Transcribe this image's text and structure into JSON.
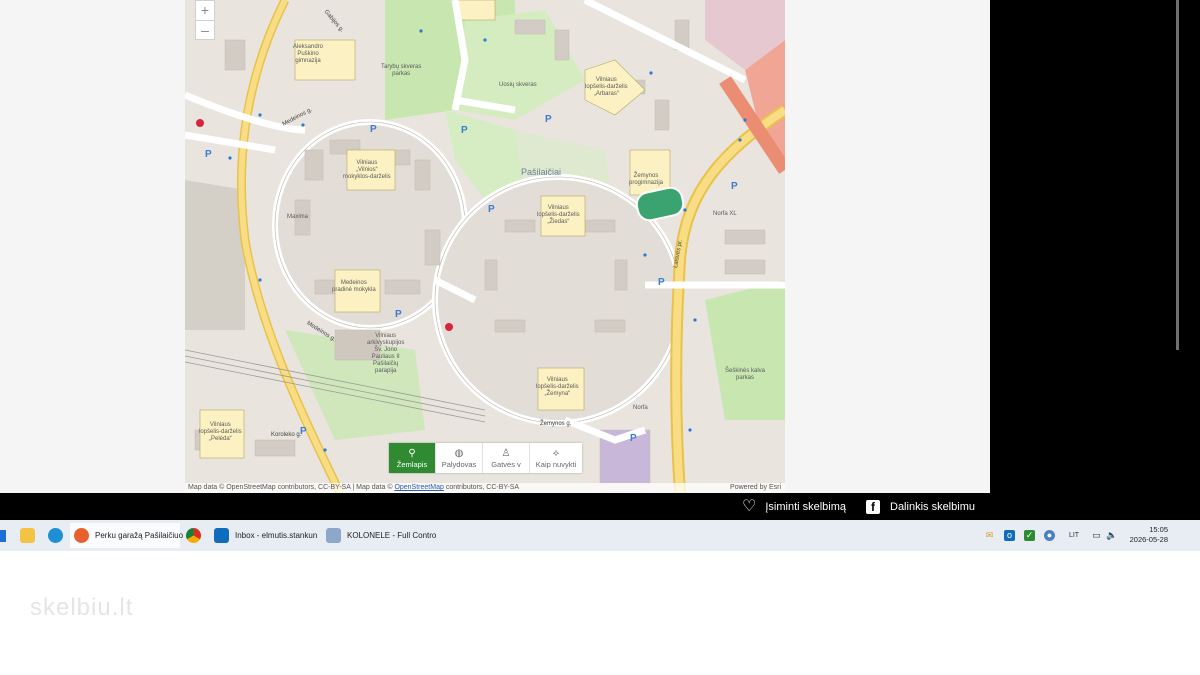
{
  "map": {
    "zoom_in": "+",
    "zoom_out": "–",
    "area_labels": [
      "Pašilaičiai",
      "Vilniaus\n„Vilnios“\nmokyklos-darželis",
      "Vilniaus\nlopšelis-darželis\n„Žiedas“",
      "Vilniaus\nlopšelis-darželis\n„Žemyna“",
      "Medeinos\npradinė mokykla",
      "Vilniaus\nlopšelis-darželis\n„Arbaras“",
      "Vilniaus\nlopšelis-darželis\n„Pelėda“",
      "Vilniaus\narkivyskupijos\nŠv. Jono\nPauliaus II\nPašilaičių\nparapija",
      "Tarybų skveras\nparkas",
      "Uosių skveras",
      "Aleksandro\nPuškino\ngimnazija",
      "Žemynos\nprogimnazija",
      "Šeškinės kalva\nparkas",
      "Norfa",
      "Maxima",
      "Norfa XL",
      "Medeinos g.",
      "Žemynos g.",
      "Laisvės pr.",
      "Medeinos g.",
      "Koroleko g.",
      "Gabijos g."
    ],
    "toolbar": [
      {
        "label": "Žemlapis",
        "icon": "map-pin-icon",
        "active": true
      },
      {
        "label": "Palydovas",
        "icon": "globe-icon",
        "active": false
      },
      {
        "label": "Gatvės v",
        "icon": "pegman-icon",
        "active": false
      },
      {
        "label": "Kaip nuvykti",
        "icon": "route-icon",
        "active": false
      }
    ],
    "attribution_prefix": "Map data © OpenStreetMap contributors, CC-BY-SA | Map data ©",
    "attribution_link": "OpenStreetMap",
    "attribution_suffix": "contributors, CC-BY-SA",
    "powered_by": "Powered by Esri"
  },
  "share_bar": {
    "remember": "Įsiminti skelbimą",
    "share": "Dalinkis skelbimu"
  },
  "taskbar": {
    "items": [
      {
        "label": "Perku garažą Pašilaičiuo",
        "icon": "firefox-icon"
      },
      {
        "label": "",
        "icon": "chrome-icon"
      },
      {
        "label": "Inbox - elmutis.stankun",
        "icon": "outlook-icon"
      },
      {
        "label": "KOLONELE - Full Contro",
        "icon": "remote-control-icon"
      }
    ],
    "language": "LIT",
    "time": "15:05",
    "date": "2026-05-28"
  },
  "watermark": "skelbiu.lt",
  "colors": {
    "map_bg": "#e9e4de",
    "park": "#c8e6b0",
    "road_major": "#f3d17a",
    "active_button": "#2f8a32",
    "taskbar": "#e8edf4"
  }
}
